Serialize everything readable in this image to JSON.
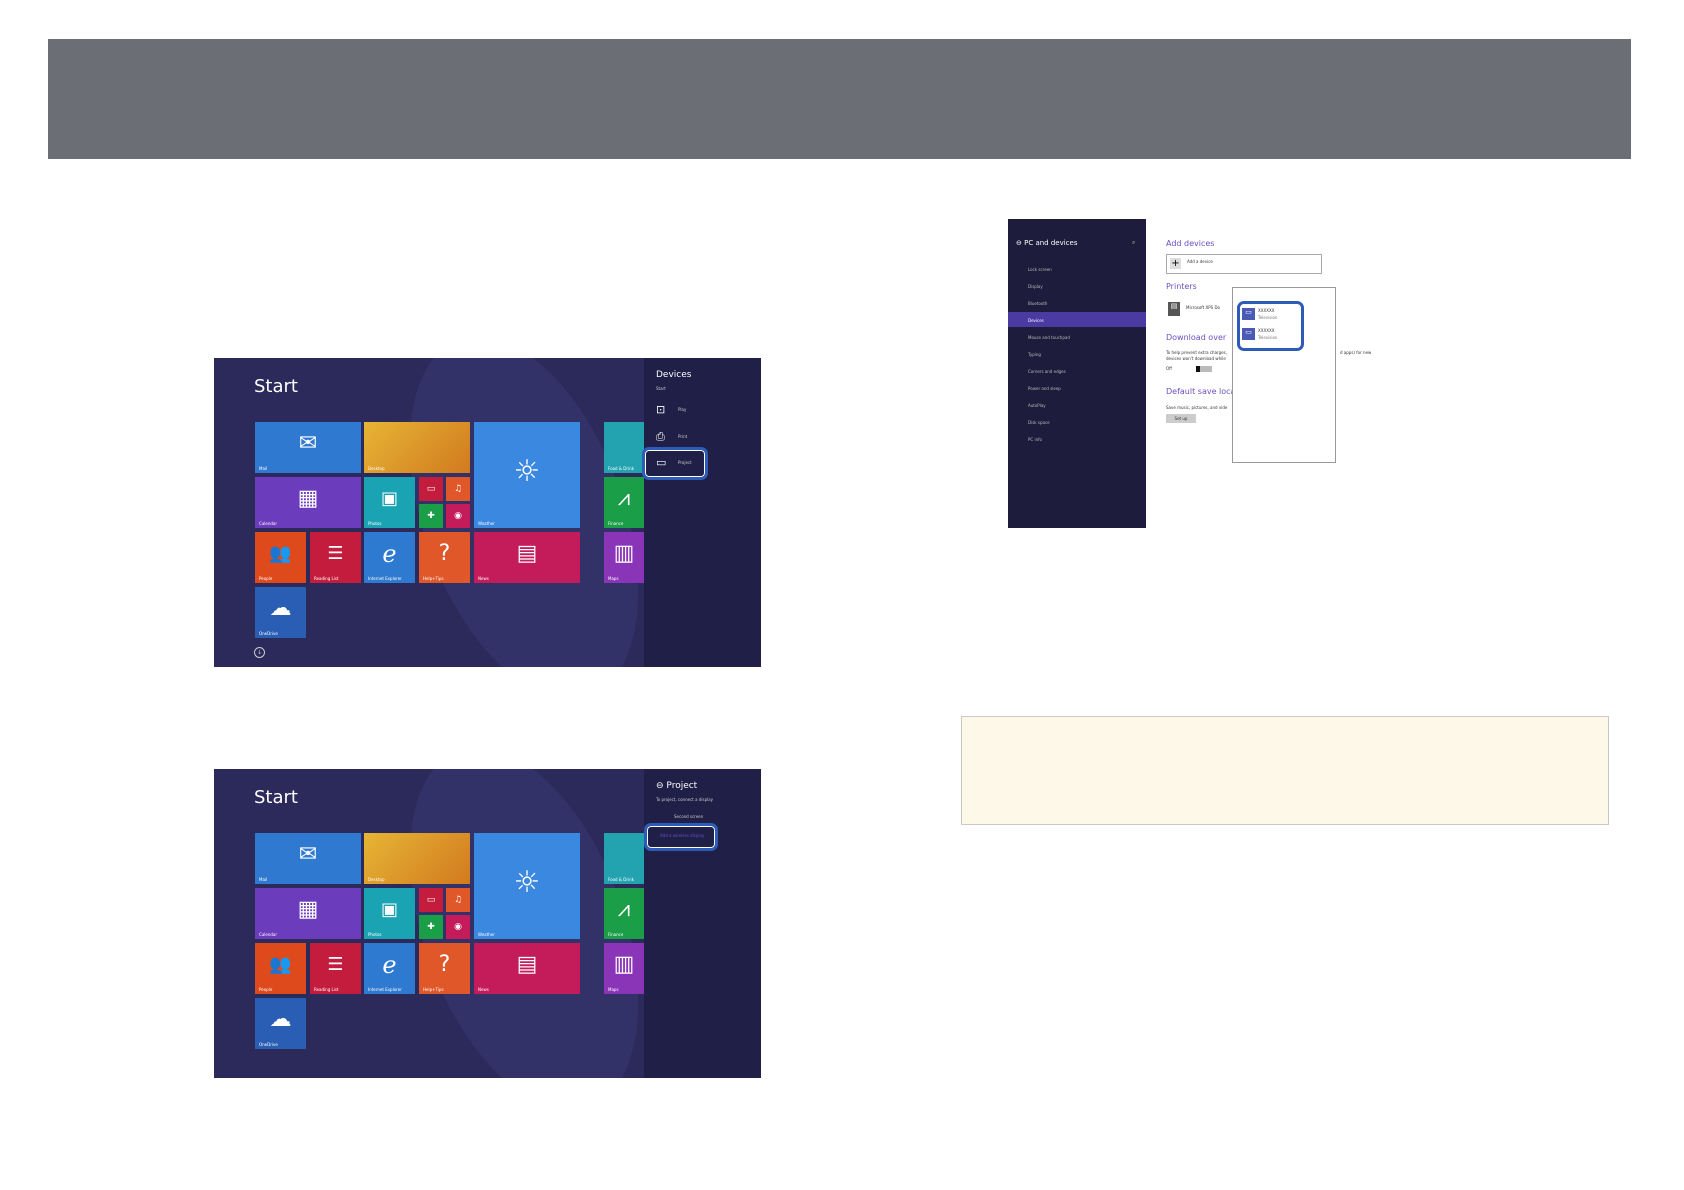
{
  "start_screens": [
    {
      "title": "Start",
      "tiles": [
        {
          "label": "Mail",
          "icon": "mail-icon",
          "color": "#2f7ad0"
        },
        {
          "label": "Desktop",
          "icon": "",
          "color": "#e0a42b"
        },
        {
          "label": "Weather",
          "icon": "sun-icon",
          "color": "#3a88e0"
        },
        {
          "label": "Food & Drink",
          "icon": "",
          "color": "#23a3b0"
        },
        {
          "label": "Calendar",
          "icon": "calendar-icon",
          "color": "#6b3dbd"
        },
        {
          "label": "Photos",
          "icon": "photo-icon",
          "color": "#1aa3b3"
        },
        {
          "label": "Finance",
          "icon": "chart-icon",
          "color": "#1a9e47"
        },
        {
          "label": "People",
          "icon": "people-icon",
          "color": "#de4a1c"
        },
        {
          "label": "Reading List",
          "icon": "list-icon",
          "color": "#c41c3c"
        },
        {
          "label": "Internet Explorer",
          "icon": "ie-icon",
          "color": "#2e7ad0"
        },
        {
          "label": "Help+Tips",
          "icon": "help-icon",
          "color": "#e0572a"
        },
        {
          "label": "News",
          "icon": "news-icon",
          "color": "#c41c5a"
        },
        {
          "label": "Maps",
          "icon": "map-icon",
          "color": "#8a35b8"
        },
        {
          "label": "OneDrive",
          "icon": "cloud-icon",
          "color": "#2a5eb5"
        }
      ],
      "charm": {
        "title": "Devices",
        "subtitle": "Start",
        "items": [
          {
            "label": "Play",
            "icon": "play-icon"
          },
          {
            "label": "Print",
            "icon": "printer-icon"
          },
          {
            "label": "Project",
            "icon": "project-icon"
          }
        ]
      }
    },
    {
      "title": "Start",
      "charm": {
        "title": "Project",
        "subtitle": "To project, connect a display",
        "items": [
          {
            "label": "Second screen",
            "icon": "screen-icon"
          },
          {
            "label": "Add a wireless display",
            "icon": ""
          }
        ]
      }
    }
  ],
  "pc_devices": {
    "title": "PC and devices",
    "menu": [
      "Lock screen",
      "Display",
      "Bluetooth",
      "Devices",
      "Mouse and touchpad",
      "Typing",
      "Corners and edges",
      "Power and sleep",
      "AutoPlay",
      "Disk space",
      "PC info"
    ],
    "selected": "Devices",
    "add_devices_heading": "Add devices",
    "add_device_label": "Add a device",
    "printers_heading": "Printers",
    "printer_name": "Microsoft XPS Do",
    "download_heading": "Download over",
    "download_text_1": "To help prevent extra charges,",
    "download_text_2": "devices won't download while",
    "download_text_tail": "d apps) for new",
    "toggle_label": "Off",
    "save_heading": "Default save loca",
    "save_text": "Save music, pictures, and vide",
    "setup_label": "Set up",
    "popup_items": [
      {
        "name": "XXXXXX",
        "type": "Television"
      },
      {
        "name": "XXXXXX",
        "type": "Television"
      }
    ]
  }
}
